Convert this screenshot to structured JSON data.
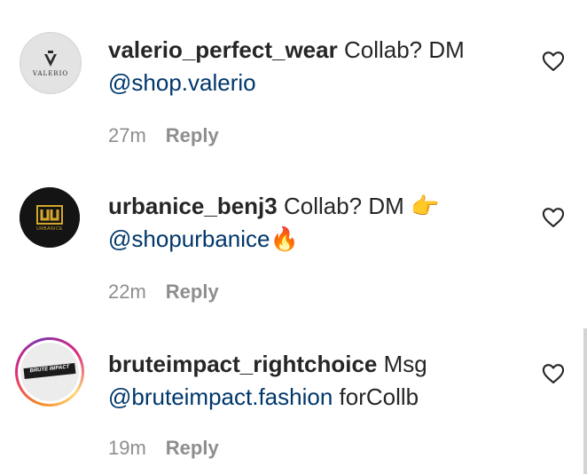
{
  "comments": [
    {
      "username": "valerio_perfect_wear",
      "text": "Collab? DM",
      "mention": "@shop.valerio",
      "suffix": "",
      "time": "27m",
      "reply_label": "Reply",
      "avatar_text": "VALERIO"
    },
    {
      "username": "urbanice_benj3",
      "text": "Collab? DM 👉",
      "mention": "@shopurbanice",
      "suffix": "🔥",
      "time": "22m",
      "reply_label": "Reply",
      "avatar_text": "URBANICE"
    },
    {
      "username": "bruteimpact_rightchoice",
      "text": "Msg",
      "mention": "@bruteimpact.fashion",
      "suffix": " forCollb",
      "time": "19m",
      "reply_label": "Reply",
      "avatar_text": "BRUTE IMPACT"
    }
  ],
  "icons": {
    "like": "heart-outline-icon"
  },
  "colors": {
    "mention": "#00376b",
    "meta": "#8e8e8e",
    "text": "#262626"
  }
}
